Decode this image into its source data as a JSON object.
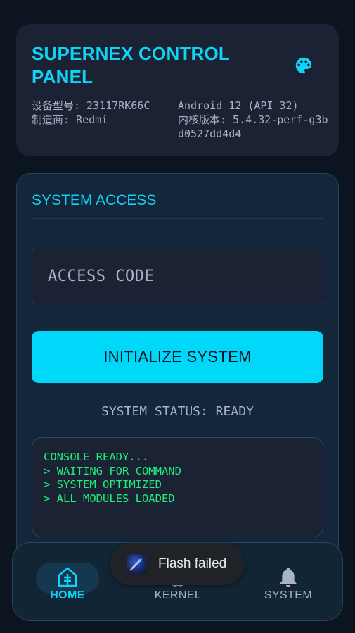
{
  "header": {
    "title": "SUPERNEX CONTROL PANEL",
    "theme_icon": "palette-icon",
    "device_model": "设备型号: 23117RK66C",
    "manufacturer": "制造商: Redmi",
    "android_version": "Android 12 (API 32)",
    "kernel_version": "内核版本: 5.4.32-perf-g3bd0527dd4d4"
  },
  "access": {
    "section_title": "SYSTEM ACCESS",
    "code_placeholder": "ACCESS CODE",
    "code_value": "",
    "init_button": "INITIALIZE SYSTEM",
    "status": "SYSTEM STATUS: READY"
  },
  "console": {
    "lines": [
      "CONSOLE READY...",
      "> WAITING FOR COMMAND",
      "> SYSTEM OPTIMIZED",
      "> ALL MODULES LOADED"
    ]
  },
  "nav": {
    "items": [
      {
        "label": "HOME",
        "icon": "home-icon",
        "active": true
      },
      {
        "label": "KERNEL",
        "icon": "kernel-icon",
        "active": false
      },
      {
        "label": "SYSTEM",
        "icon": "bell-icon",
        "active": false
      }
    ]
  },
  "toast": {
    "text": "Flash failed",
    "icon": "app-icon"
  },
  "colors": {
    "background": "#0c1420",
    "accent": "#10d4f6",
    "button": "#00d8fa",
    "console_text": "#1ef07c",
    "muted_text": "#a9b3c5"
  }
}
